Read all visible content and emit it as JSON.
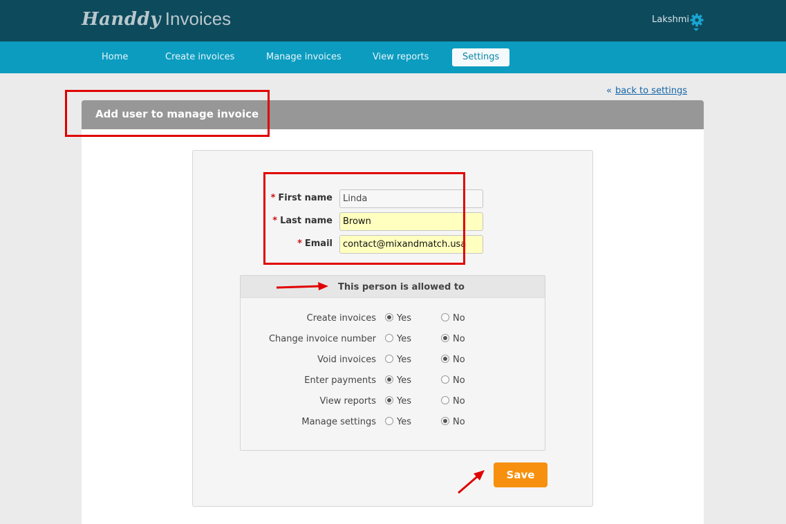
{
  "app": {
    "logo_script": "Handdy",
    "logo_plain": "Invoices",
    "user_name": "Lakshmi",
    "settings_icon": "gear-icon"
  },
  "nav": {
    "items": [
      {
        "label": "Home"
      },
      {
        "label": "Create invoices"
      },
      {
        "label": "Manage invoices"
      },
      {
        "label": "View reports"
      },
      {
        "label": "Settings",
        "active": true
      }
    ]
  },
  "page": {
    "back_link": "back to settings",
    "back_icon": "double-chevron-left-icon",
    "title": "Add user to manage invoice"
  },
  "form": {
    "required_marker": "*",
    "first_name": {
      "label": "First name",
      "value": "Linda"
    },
    "last_name": {
      "label": "Last name",
      "value": "Brown"
    },
    "email": {
      "label": "Email",
      "value": "contact@mixandmatch.usa"
    }
  },
  "permissions": {
    "title": "This person is allowed to",
    "yes_label": "Yes",
    "no_label": "No",
    "rows": [
      {
        "label": "Create invoices",
        "value": "Yes"
      },
      {
        "label": "Change invoice number",
        "value": "No"
      },
      {
        "label": "Void invoices",
        "value": "No"
      },
      {
        "label": "Enter payments",
        "value": "Yes"
      },
      {
        "label": "View reports",
        "value": "Yes"
      },
      {
        "label": "Manage settings",
        "value": "No"
      }
    ]
  },
  "actions": {
    "save_label": "Save"
  },
  "colors": {
    "topbar": "#0d4a5c",
    "navbar": "#0c9cc0",
    "save_button": "#f7900e",
    "highlight_field": "#ffffbf",
    "annotation": "#e00000"
  }
}
